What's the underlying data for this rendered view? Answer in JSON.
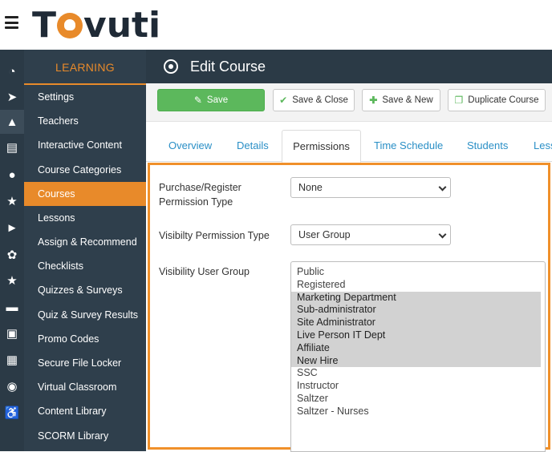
{
  "brand": {
    "name": "Tovuti",
    "accent": "#e88a2a",
    "sidebar_bg": "#2f3f4c",
    "rail_bg": "#2b3a46"
  },
  "rail_icons": [
    "dashboard-icon",
    "rocket-icon",
    "graduation-cap-icon",
    "bar-chart-icon",
    "users-icon",
    "trophy-icon",
    "megaphone-icon",
    "feather-icon",
    "star-icon",
    "credit-card-icon",
    "id-badge-icon",
    "calendar-icon",
    "chat-icon",
    "accessibility-icon"
  ],
  "sidebar": {
    "header": "LEARNING",
    "items": [
      {
        "label": "Settings"
      },
      {
        "label": "Teachers"
      },
      {
        "label": "Interactive Content"
      },
      {
        "label": "Course Categories"
      },
      {
        "label": "Courses",
        "active": true
      },
      {
        "label": "Lessons"
      },
      {
        "label": "Assign & Recommend"
      },
      {
        "label": "Checklists"
      },
      {
        "label": "Quizzes & Surveys"
      },
      {
        "label": "Quiz & Survey Results"
      },
      {
        "label": "Promo Codes"
      },
      {
        "label": "Secure File Locker"
      },
      {
        "label": "Virtual Classroom"
      },
      {
        "label": "Content Library"
      },
      {
        "label": "SCORM Library"
      }
    ]
  },
  "header": {
    "title": "Edit Course"
  },
  "toolbar": {
    "save": "Save",
    "save_close": "Save & Close",
    "save_new": "Save & New",
    "duplicate": "Duplicate Course"
  },
  "tabs": [
    {
      "label": "Overview"
    },
    {
      "label": "Details"
    },
    {
      "label": "Permissions",
      "active": true
    },
    {
      "label": "Time Schedule"
    },
    {
      "label": "Students"
    },
    {
      "label": "Less"
    }
  ],
  "permissions": {
    "purchase_label": "Purchase/Register Permission Type",
    "purchase_value": "None",
    "visibility_type_label": "Visibilty Permission Type",
    "visibility_type_value": "User Group",
    "visibility_group_label": "Visibility User Group",
    "groups": [
      {
        "name": "Public",
        "selected": false
      },
      {
        "name": "Registered",
        "selected": false
      },
      {
        "name": "Marketing Department",
        "selected": true
      },
      {
        "name": "Sub-administrator",
        "selected": true
      },
      {
        "name": "Site Administrator",
        "selected": true
      },
      {
        "name": "Live Person IT Dept",
        "selected": true
      },
      {
        "name": "Affiliate",
        "selected": true
      },
      {
        "name": "New Hire",
        "selected": true
      },
      {
        "name": "SSC",
        "selected": false
      },
      {
        "name": "Instructor",
        "selected": false
      },
      {
        "name": "Saltzer",
        "selected": false
      },
      {
        "name": "Saltzer - Nurses",
        "selected": false
      }
    ]
  }
}
